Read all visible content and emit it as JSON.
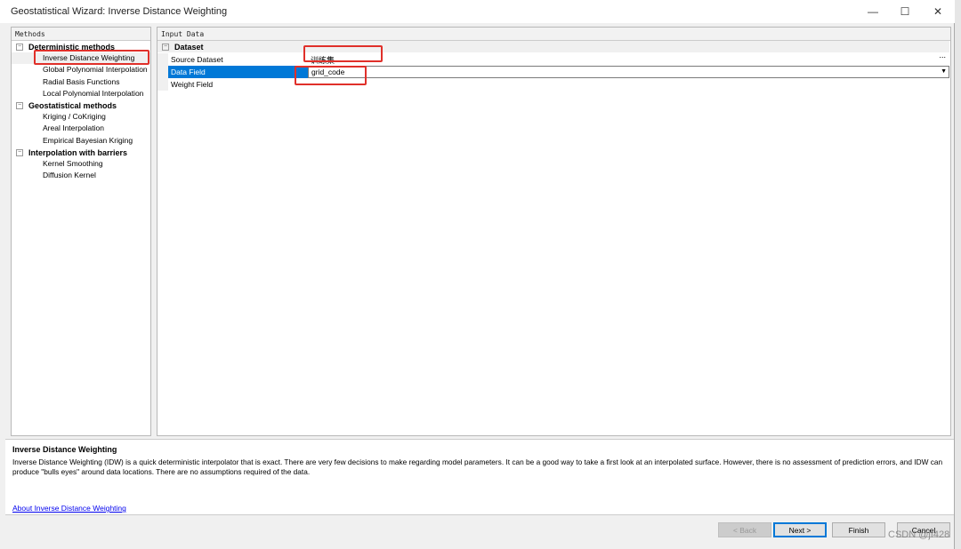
{
  "window": {
    "title": "Geostatistical Wizard: Inverse Distance Weighting",
    "minimize": "—",
    "maximize": "☐",
    "close": "✕"
  },
  "methods": {
    "header": "Methods",
    "groups": [
      {
        "label": "Deterministic methods",
        "items": [
          "Inverse Distance Weighting",
          "Global Polynomial Interpolation",
          "Radial Basis Functions",
          "Local Polynomial Interpolation"
        ]
      },
      {
        "label": "Geostatistical methods",
        "items": [
          "Kriging / CoKriging",
          "Areal Interpolation",
          "Empirical Bayesian Kriging"
        ]
      },
      {
        "label": "Interpolation with barriers",
        "items": [
          "Kernel Smoothing",
          "Diffusion Kernel"
        ]
      }
    ],
    "selected": "Inverse Distance Weighting"
  },
  "input": {
    "header": "Input Data",
    "group": "Dataset",
    "rows": [
      {
        "label": "Source Dataset",
        "value": "训练集"
      },
      {
        "label": "Data Field",
        "value": "grid_code"
      },
      {
        "label": "Weight Field",
        "value": ""
      }
    ],
    "browse": "...",
    "dropdown": "▼"
  },
  "description": {
    "title": "Inverse Distance Weighting",
    "text": "Inverse Distance Weighting (IDW) is a quick deterministic interpolator that is exact. There are very few decisions to make regarding model parameters. It can be a good way to take a first look at an interpolated surface. However, there is no assessment of prediction errors, and IDW can produce \"bulls eyes\" around data locations. There are no assumptions required of the data.",
    "link": "About Inverse Distance Weighting"
  },
  "buttons": {
    "back": "< Back",
    "next": "Next >",
    "finish": "Finish",
    "cancel": "Cancel"
  },
  "watermark": "CSDN @jf428",
  "colors": {
    "selection": "#0078d7",
    "highlight": "#e0302a",
    "link": "#0000ee"
  }
}
